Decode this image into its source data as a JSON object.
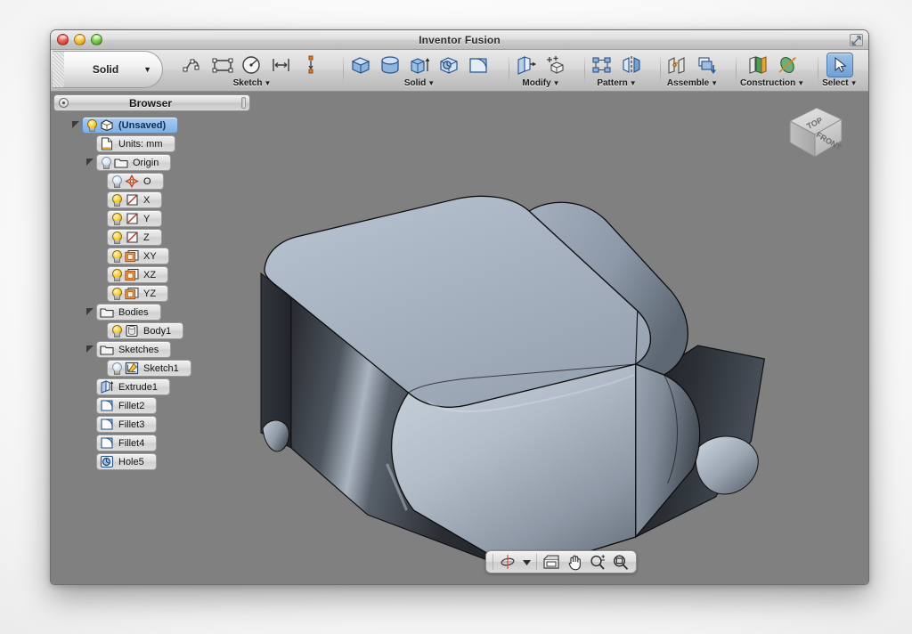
{
  "window": {
    "title": "Inventor Fusion",
    "controls": {
      "close": "close-button",
      "minimize": "minimize-button",
      "zoom": "zoom-button"
    },
    "resize_grip": "↗"
  },
  "toolbar": {
    "workspace": {
      "label": "Solid",
      "caret": "▼"
    },
    "groups": [
      {
        "label": "Sketch",
        "caret": "▼",
        "icons": [
          "sketch-line-icon",
          "sketch-rectangle-icon",
          "sketch-circle-icon",
          "sketch-dimension-icon",
          "sketch-constraint-icon"
        ]
      },
      {
        "label": "Solid",
        "caret": "▼",
        "icons": [
          "solid-box-icon",
          "solid-cylinder-icon",
          "solid-extrude-icon",
          "solid-hole-icon",
          "solid-fillet-icon"
        ]
      },
      {
        "label": "Modify",
        "caret": "▼",
        "icons": [
          "modify-press-pull-icon",
          "modify-move-icon"
        ]
      },
      {
        "label": "Pattern",
        "caret": "▼",
        "icons": [
          "pattern-rectangular-icon",
          "pattern-mirror-icon"
        ]
      },
      {
        "label": "Assemble",
        "caret": "▼",
        "icons": [
          "assemble-joint-icon",
          "assemble-insert-icon"
        ]
      },
      {
        "label": "Construction",
        "caret": "▼",
        "icons": [
          "construction-plane-icon",
          "construction-axis-icon"
        ]
      },
      {
        "label": "Select",
        "caret": "▼",
        "icons": [
          "select-arrow-icon"
        ],
        "active": true
      }
    ]
  },
  "browser": {
    "title": "Browser",
    "menu_icon": "browser-options-icon",
    "tree": [
      {
        "label": "(Unsaved)",
        "icon": "document-solid-icon",
        "bulb": "on",
        "disclosure": "open",
        "depth": 0,
        "selected": true
      },
      {
        "label": "Units: mm",
        "icon": "units-page-icon",
        "bulb": "none",
        "disclosure": "none",
        "depth": 1,
        "selected": false
      },
      {
        "label": "Origin",
        "icon": "folder-icon",
        "bulb": "off",
        "disclosure": "open",
        "depth": 1,
        "selected": false
      },
      {
        "label": "O",
        "icon": "origin-point-icon",
        "bulb": "off",
        "disclosure": "none",
        "depth": 2,
        "selected": false
      },
      {
        "label": "X",
        "icon": "axis-icon",
        "bulb": "on",
        "disclosure": "none",
        "depth": 2,
        "selected": false
      },
      {
        "label": "Y",
        "icon": "axis-icon",
        "bulb": "on",
        "disclosure": "none",
        "depth": 2,
        "selected": false
      },
      {
        "label": "Z",
        "icon": "axis-icon",
        "bulb": "on",
        "disclosure": "none",
        "depth": 2,
        "selected": false
      },
      {
        "label": "XY",
        "icon": "plane-icon",
        "bulb": "on",
        "disclosure": "none",
        "depth": 2,
        "selected": false
      },
      {
        "label": "XZ",
        "icon": "plane-icon",
        "bulb": "on",
        "disclosure": "none",
        "depth": 2,
        "selected": false
      },
      {
        "label": "YZ",
        "icon": "plane-icon",
        "bulb": "on",
        "disclosure": "none",
        "depth": 2,
        "selected": false
      },
      {
        "label": "Bodies",
        "icon": "folder-icon",
        "bulb": "none",
        "disclosure": "open",
        "depth": 1,
        "selected": false
      },
      {
        "label": "Body1",
        "icon": "body-icon",
        "bulb": "on",
        "disclosure": "none",
        "depth": 2,
        "selected": false
      },
      {
        "label": "Sketches",
        "icon": "folder-icon",
        "bulb": "none",
        "disclosure": "open",
        "depth": 1,
        "selected": false
      },
      {
        "label": "Sketch1",
        "icon": "sketch-icon",
        "bulb": "off",
        "disclosure": "none",
        "depth": 2,
        "selected": false
      },
      {
        "label": "Extrude1",
        "icon": "extrude-feature-icon",
        "bulb": "none",
        "disclosure": "none",
        "depth": 1,
        "selected": false
      },
      {
        "label": "Fillet2",
        "icon": "fillet-feature-icon",
        "bulb": "none",
        "disclosure": "none",
        "depth": 1,
        "selected": false
      },
      {
        "label": "Fillet3",
        "icon": "fillet-feature-icon",
        "bulb": "none",
        "disclosure": "none",
        "depth": 1,
        "selected": false
      },
      {
        "label": "Fillet4",
        "icon": "fillet-feature-icon",
        "bulb": "none",
        "disclosure": "none",
        "depth": 1,
        "selected": false
      },
      {
        "label": "Hole5",
        "icon": "hole-feature-icon",
        "bulb": "none",
        "disclosure": "none",
        "depth": 1,
        "selected": false
      }
    ]
  },
  "viewport": {
    "background_color": "#808080",
    "viewcube": {
      "top_face": "TOP",
      "front_face": "FRONT"
    },
    "model": {
      "name": "body1-solid-model",
      "highlight_color": "#c9d3de",
      "midtone_color": "#8e9aa8",
      "shadow_color": "#2a2d33"
    },
    "navbar": {
      "buttons": [
        "orbit-icon",
        "orbit-dropdown-caret",
        "look-at-icon",
        "pan-hand-icon",
        "zoom-in-out-icon",
        "zoom-window-icon"
      ],
      "caret": "▼"
    }
  }
}
